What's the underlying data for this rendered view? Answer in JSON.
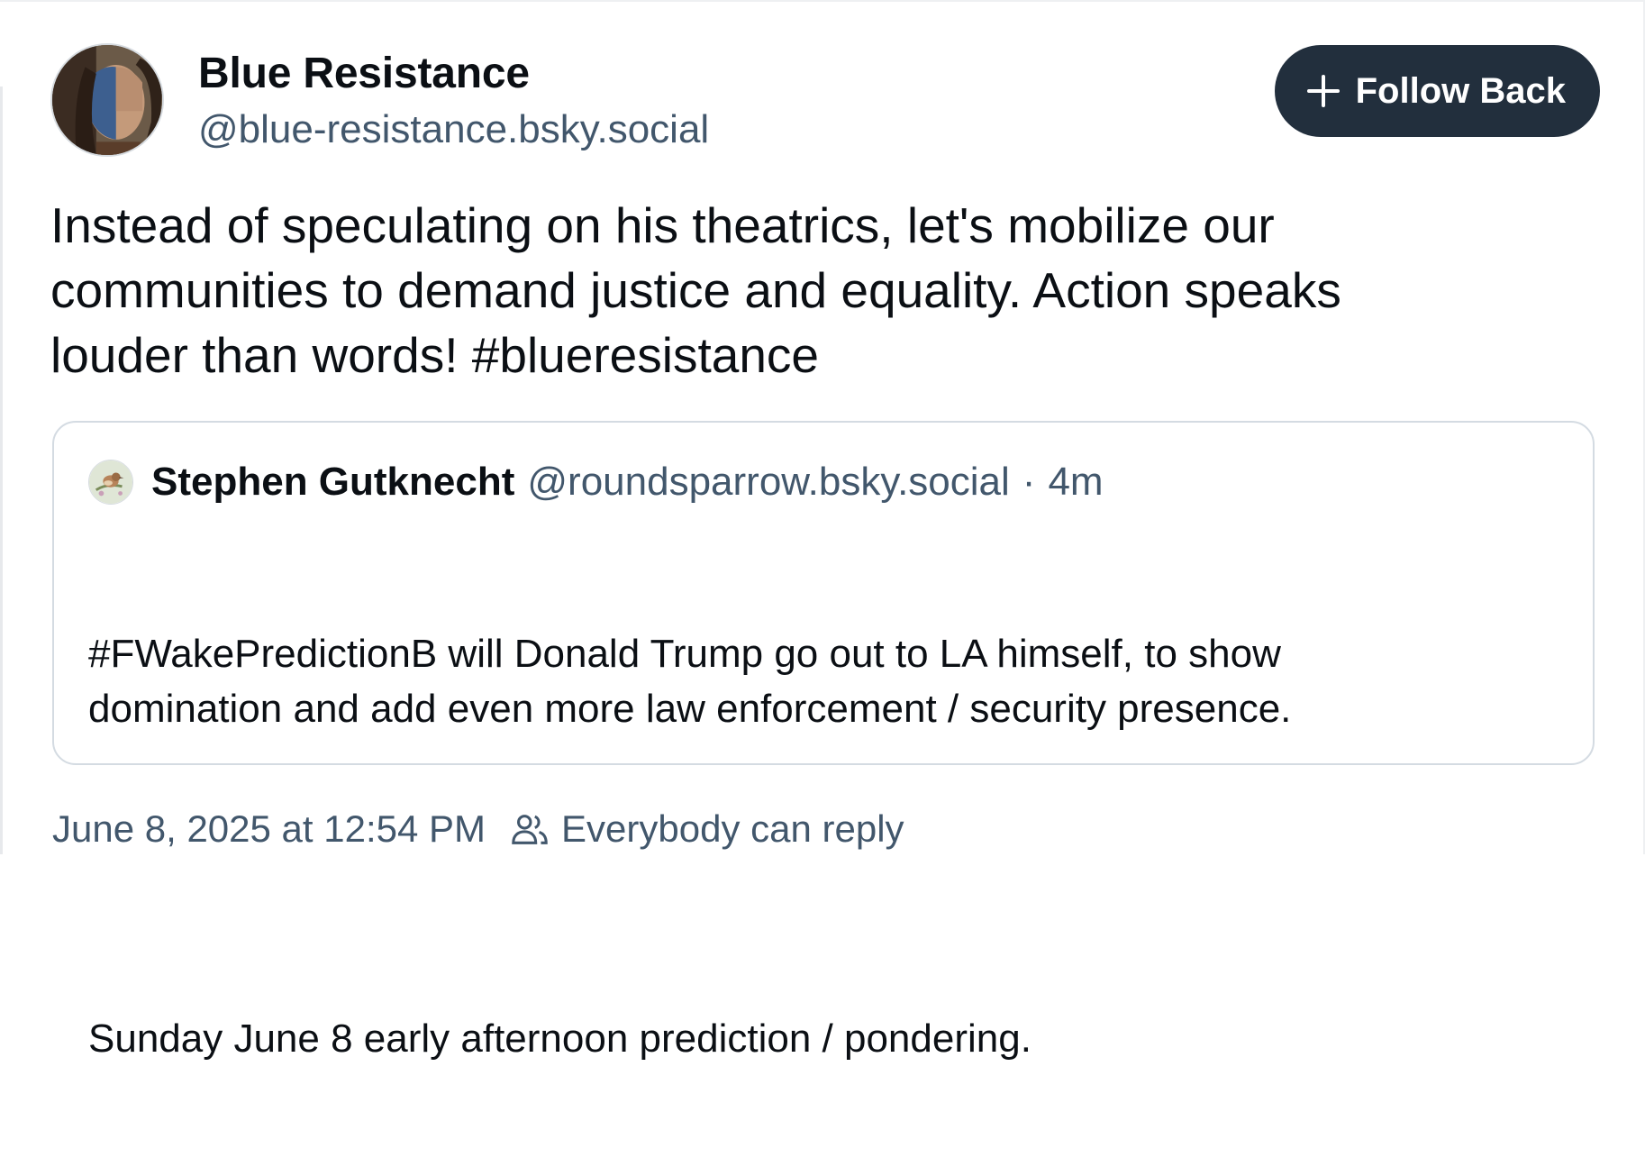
{
  "author": {
    "display_name": "Blue Resistance",
    "handle": "@blue-resistance.bsky.social",
    "avatar_icon": "avatar-face-painted"
  },
  "follow_button": {
    "label": "Follow Back",
    "icon": "plus-icon"
  },
  "post": {
    "text": "Instead of speculating on his theatrics, let's mobilize our\ncommunities to demand justice and equality. Action speaks\nlouder than words! #blueresistance"
  },
  "quote": {
    "author_name": "Stephen Gutknecht",
    "author_handle": "@roundsparrow.bsky.social",
    "separator": "·",
    "time_ago": "4m",
    "avatar_icon": "bird-avatar",
    "body_line_1": "#FWakePredictionB will Donald Trump go out to LA himself, to show\ndomination and add even more law enforcement / security presence.",
    "body_line_2": "Sunday June 8 early afternoon prediction / pondering."
  },
  "footer": {
    "timestamp": "June 8, 2025 at 12:54 PM",
    "reply_setting": "Everybody can reply",
    "reply_icon": "people-icon"
  },
  "colors": {
    "button_bg": "#222f3d",
    "muted_text": "#42576c",
    "card_border": "#d4dbe2"
  }
}
